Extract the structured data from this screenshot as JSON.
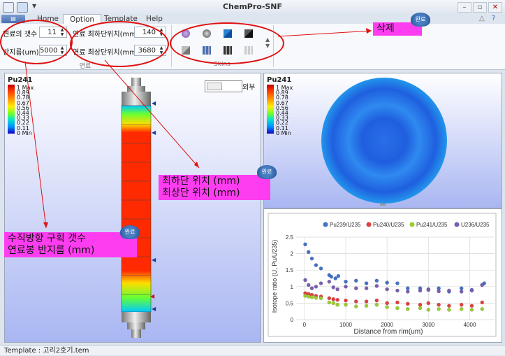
{
  "window": {
    "title": "ChemPro-SNF"
  },
  "tabs": [
    "Home",
    "Option",
    "Template",
    "Help"
  ],
  "ribbon": {
    "fuel_count_label": "연료의 갯수",
    "fuel_count_value": "11",
    "radius_label": "반지름(um)",
    "radius_value": "5000",
    "bottom_pos_label": "연료 최하단위치(mm)",
    "bottom_pos_value": "140",
    "top_pos_label": "연료 최상단위치(mm)",
    "top_pos_value": "3680",
    "group_fuel_label": "연료",
    "group_skins_label": "Skins"
  },
  "left_panel": {
    "title": "Pu241",
    "toggle_label": "외부",
    "legend": [
      "1 Max",
      "0.89",
      "0.78",
      "0.67",
      "0.56",
      "0.44",
      "0.33",
      "0.22",
      "0.11",
      "0 Min"
    ]
  },
  "right_top_panel": {
    "title": "Pu241",
    "legend": [
      "1 Max",
      "0.89",
      "0.78",
      "0.67",
      "0.56",
      "0.44",
      "0.33",
      "0.22",
      "0.11",
      "0 Min"
    ]
  },
  "annotations": {
    "delete": "삭제",
    "done_badge": "완료",
    "pos_line1": "최하단 위치 (mm)",
    "pos_line2": "최상단 위치 (mm)",
    "vert_line1": "수직방향 구획 갯수",
    "vert_line2": "연료봉 반지름 (mm)"
  },
  "status": {
    "text": "Template : 고리2호기.tem"
  },
  "colors": {
    "pu239": "#4472c4",
    "pu240": "#e04040",
    "pu241": "#9acd32",
    "u236": "#7a5fb0"
  },
  "chart_data": {
    "type": "scatter",
    "xlabel": "Distance from rim(um)",
    "ylabel": "Isotope ratio (U, Pu/U235)",
    "xlim": [
      -200,
      4600
    ],
    "ylim": [
      0,
      2.5
    ],
    "xticks": [
      0,
      1000,
      2000,
      3000,
      4000
    ],
    "yticks": [
      0,
      0.5,
      1,
      1.5,
      2,
      2.5
    ],
    "series": [
      {
        "name": "Pu239/U235",
        "color_key": "pu239",
        "x": [
          20,
          100,
          180,
          280,
          400,
          600,
          650,
          750,
          820,
          1000,
          1250,
          1500,
          1750,
          2000,
          2250,
          2500,
          2800,
          3000,
          3250,
          3500,
          3800,
          4050,
          4300,
          4350
        ],
        "y": [
          2.28,
          2.05,
          1.85,
          1.65,
          1.55,
          1.35,
          1.3,
          1.25,
          1.32,
          1.15,
          1.18,
          1.1,
          1.18,
          1.12,
          1.1,
          0.95,
          0.95,
          0.92,
          0.95,
          0.85,
          0.95,
          0.9,
          1.05,
          1.1
        ]
      },
      {
        "name": "Pu240/U235",
        "color_key": "pu240",
        "x": [
          20,
          100,
          180,
          280,
          400,
          600,
          700,
          800,
          1000,
          1250,
          1500,
          1750,
          2000,
          2250,
          2500,
          2800,
          3000,
          3250,
          3500,
          3800,
          4050,
          4300
        ],
        "y": [
          0.8,
          0.78,
          0.75,
          0.72,
          0.7,
          0.65,
          0.62,
          0.6,
          0.58,
          0.55,
          0.55,
          0.58,
          0.5,
          0.52,
          0.48,
          0.45,
          0.5,
          0.45,
          0.42,
          0.45,
          0.42,
          0.52
        ]
      },
      {
        "name": "Pu241/U235",
        "color_key": "pu241",
        "x": [
          20,
          100,
          180,
          280,
          400,
          600,
          700,
          800,
          1000,
          1250,
          1500,
          1750,
          2000,
          2250,
          2500,
          2800,
          3000,
          3250,
          3500,
          3800,
          4050,
          4300
        ],
        "y": [
          0.72,
          0.7,
          0.68,
          0.66,
          0.65,
          0.52,
          0.5,
          0.45,
          0.45,
          0.4,
          0.42,
          0.45,
          0.38,
          0.35,
          0.32,
          0.35,
          0.3,
          0.32,
          0.3,
          0.32,
          0.3,
          0.32
        ]
      },
      {
        "name": "U236/U235",
        "color_key": "u236",
        "x": [
          20,
          100,
          180,
          280,
          400,
          600,
          700,
          800,
          1000,
          1250,
          1500,
          1750,
          2000,
          2250,
          2500,
          2800,
          3000,
          3250,
          3500,
          3800,
          4050,
          4300
        ],
        "y": [
          1.2,
          1.05,
          0.95,
          1.0,
          1.1,
          1.15,
          0.98,
          0.92,
          1.0,
          0.95,
          0.95,
          1.02,
          0.92,
          0.88,
          0.85,
          0.88,
          0.9,
          0.86,
          0.88,
          0.85,
          0.88,
          1.05
        ]
      }
    ]
  }
}
